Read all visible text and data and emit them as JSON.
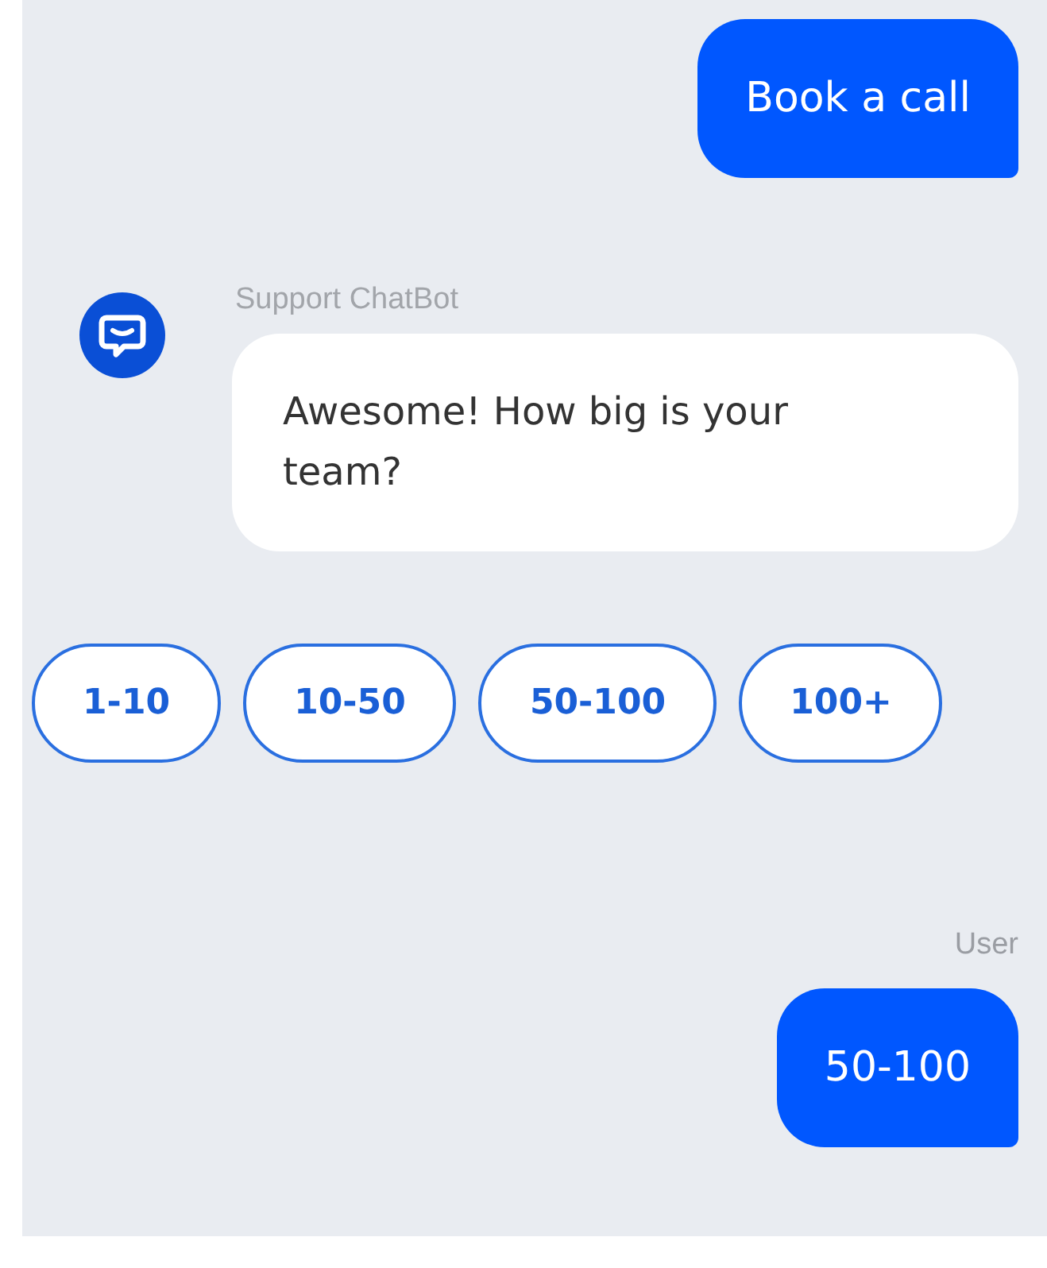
{
  "messages": [
    {
      "kind": "user",
      "text": "Book a call"
    },
    {
      "kind": "bot",
      "sender": "Support ChatBot",
      "text": "Awesome! How big is your team?"
    },
    {
      "kind": "options",
      "options": [
        "1-10",
        "10-50",
        "50-100",
        "100+"
      ]
    },
    {
      "kind": "user",
      "sender": "User",
      "text": "50-100"
    }
  ]
}
